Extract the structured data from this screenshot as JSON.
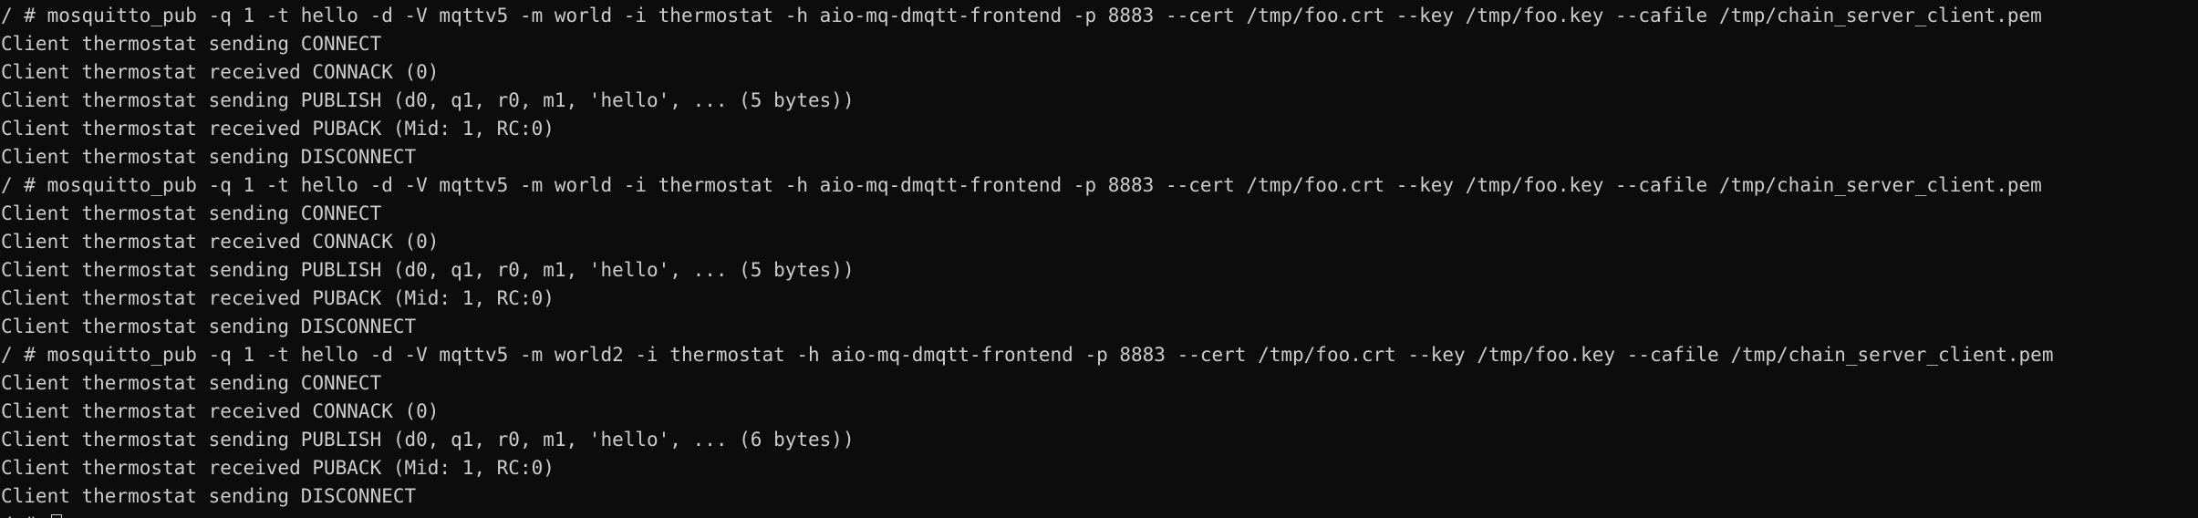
{
  "terminal": {
    "lines": [
      {
        "type": "command",
        "text": "/ # mosquitto_pub -q 1 -t hello -d -V mqttv5 -m world -i thermostat -h aio-mq-dmqtt-frontend -p 8883 --cert /tmp/foo.crt --key /tmp/foo.key --cafile /tmp/chain_server_client.pem"
      },
      {
        "type": "output",
        "text": "Client thermostat sending CONNECT"
      },
      {
        "type": "output",
        "text": "Client thermostat received CONNACK (0)"
      },
      {
        "type": "output",
        "text": "Client thermostat sending PUBLISH (d0, q1, r0, m1, 'hello', ... (5 bytes))"
      },
      {
        "type": "output",
        "text": "Client thermostat received PUBACK (Mid: 1, RC:0)"
      },
      {
        "type": "output",
        "text": "Client thermostat sending DISCONNECT"
      },
      {
        "type": "command",
        "text": "/ # mosquitto_pub -q 1 -t hello -d -V mqttv5 -m world -i thermostat -h aio-mq-dmqtt-frontend -p 8883 --cert /tmp/foo.crt --key /tmp/foo.key --cafile /tmp/chain_server_client.pem"
      },
      {
        "type": "output",
        "text": "Client thermostat sending CONNECT"
      },
      {
        "type": "output",
        "text": "Client thermostat received CONNACK (0)"
      },
      {
        "type": "output",
        "text": "Client thermostat sending PUBLISH (d0, q1, r0, m1, 'hello', ... (5 bytes))"
      },
      {
        "type": "output",
        "text": "Client thermostat received PUBACK (Mid: 1, RC:0)"
      },
      {
        "type": "output",
        "text": "Client thermostat sending DISCONNECT"
      },
      {
        "type": "command",
        "text": "/ # mosquitto_pub -q 1 -t hello -d -V mqttv5 -m world2 -i thermostat -h aio-mq-dmqtt-frontend -p 8883 --cert /tmp/foo.crt --key /tmp/foo.key --cafile /tmp/chain_server_client.pem"
      },
      {
        "type": "output",
        "text": "Client thermostat sending CONNECT"
      },
      {
        "type": "output",
        "text": "Client thermostat received CONNACK (0)"
      },
      {
        "type": "output",
        "text": "Client thermostat sending PUBLISH (d0, q1, r0, m1, 'hello', ... (6 bytes))"
      },
      {
        "type": "output",
        "text": "Client thermostat received PUBACK (Mid: 1, RC:0)"
      },
      {
        "type": "output",
        "text": "Client thermostat sending DISCONNECT"
      }
    ],
    "prompt": "/ # "
  },
  "colors": {
    "background": "#0c0c0c",
    "foreground": "#cccccc"
  }
}
